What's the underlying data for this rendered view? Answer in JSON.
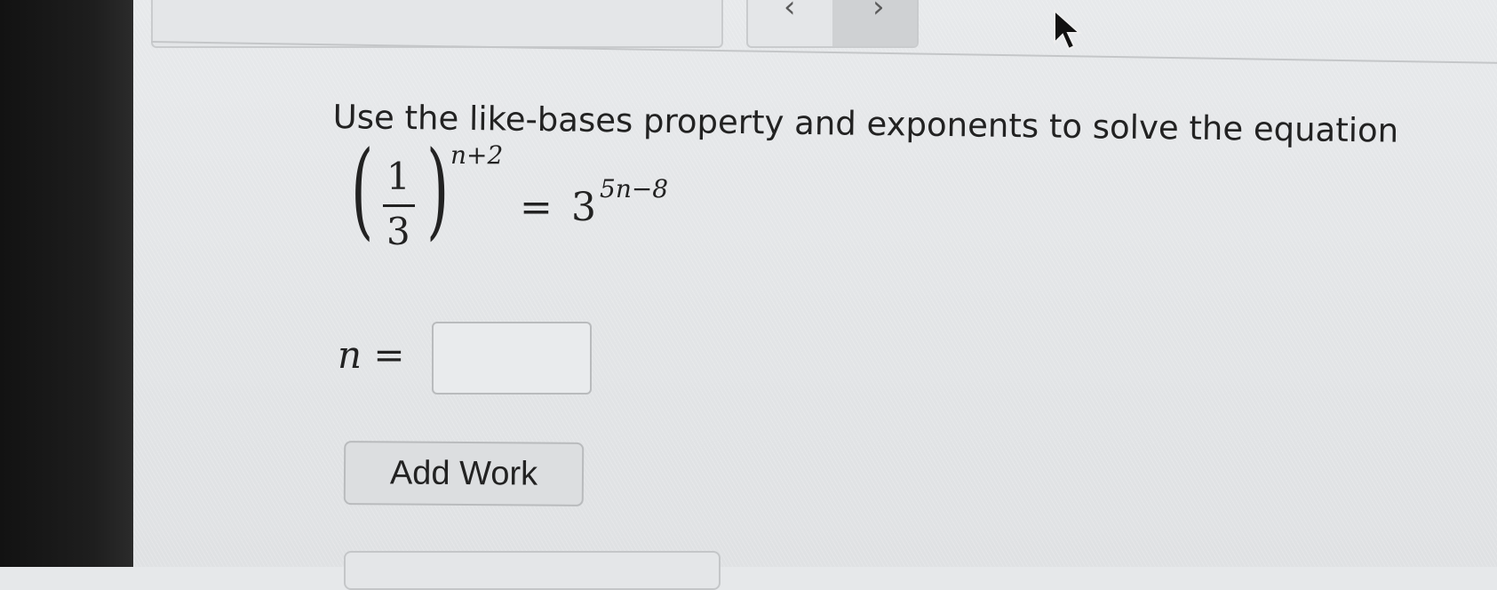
{
  "question": {
    "prompt": "Use the like-bases property and exponents to solve the equation",
    "equation": {
      "numerator": "1",
      "denominator": "3",
      "left_exponent": "n+2",
      "equals": "=",
      "right_base": "3",
      "right_exponent": "5n−8"
    }
  },
  "answer": {
    "label": "n",
    "equals": "=",
    "value": "",
    "placeholder": ""
  },
  "buttons": {
    "add_work": "Add Work"
  },
  "icons": {
    "prev": "chevron-left-icon",
    "next": "chevron-right-icon",
    "cursor": "mouse-pointer-icon"
  }
}
